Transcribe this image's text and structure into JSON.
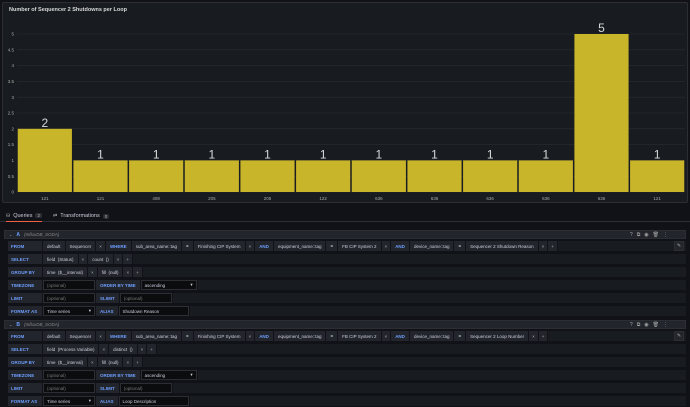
{
  "panel": {
    "title": "Number of Sequencer 2 Shutdowns per Loop"
  },
  "chart_data": {
    "type": "bar",
    "categories": [
      "121",
      "121",
      "408",
      "205",
      "205",
      "122",
      "636",
      "636",
      "636",
      "636",
      "636",
      "121"
    ],
    "values": [
      2,
      1,
      1,
      1,
      1,
      1,
      1,
      1,
      1,
      1,
      5,
      1
    ],
    "ylim": [
      0,
      5
    ],
    "yticks": [
      "0",
      "0.5",
      "1",
      "1.5",
      "2",
      "2.5",
      "3",
      "3.5",
      "4",
      "4.5",
      "5"
    ],
    "bar_color": "#c9b52a",
    "grid": true
  },
  "tabs": [
    {
      "label": "Queries",
      "count": "2",
      "icon": "database-icon"
    },
    {
      "label": "Transformations",
      "count": "0",
      "icon": "transform-icon"
    }
  ],
  "queries": [
    {
      "letter": "A",
      "datasource": "(InfluxDB_SODA)",
      "from": {
        "kw": "FROM",
        "policy": "default",
        "measurement": "Sequencer"
      },
      "where": {
        "kw": "WHERE",
        "conds": [
          {
            "key": "sub_area_name::tag",
            "op": "=",
            "value": "Finishing CIP System",
            "join": "AND"
          },
          {
            "key": "equipment_name::tag",
            "op": "=",
            "value": "FB CIP System 2",
            "join": "AND"
          },
          {
            "key": "device_name::tag",
            "op": "=",
            "value": "Sequencer 2 Shutdown Reason",
            "join": ""
          }
        ]
      },
      "select": {
        "kw": "SELECT",
        "field": "field",
        "field_arg": "(Status)",
        "fn": "count",
        "fn_arg": "()"
      },
      "groupby": {
        "kw": "GROUP BY",
        "time": "time",
        "time_arg": "($__interval)",
        "fill": "fill",
        "fill_arg": "(null)"
      },
      "timezone": {
        "kw": "TIMEZONE",
        "placeholder": "(optional)",
        "order_kw": "ORDER BY TIME",
        "order_value": "ascending"
      },
      "limit": {
        "kw": "LIMIT",
        "placeholder": "(optional)",
        "slimit_kw": "SLIMIT",
        "slimit_placeholder": "(optional)"
      },
      "format": {
        "kw": "FORMAT AS",
        "value": "Time series",
        "alias_kw": "ALIAS",
        "alias_value": "Shutdown Reason"
      }
    },
    {
      "letter": "B",
      "datasource": "(InfluxDB_SODA)",
      "from": {
        "kw": "FROM",
        "policy": "default",
        "measurement": "Sequencer"
      },
      "where": {
        "kw": "WHERE",
        "conds": [
          {
            "key": "sub_area_name::tag",
            "op": "=",
            "value": "Finishing CIP System",
            "join": "AND"
          },
          {
            "key": "equipment_name::tag",
            "op": "=",
            "value": "FB CIP System 2",
            "join": "AND"
          },
          {
            "key": "device_name::tag",
            "op": "=",
            "value": "Sequencer 2 Loop Number",
            "join": ""
          }
        ]
      },
      "select": {
        "kw": "SELECT",
        "field": "field",
        "field_arg": "(Process Variable)",
        "fn": "distinct",
        "fn_arg": "()"
      },
      "groupby": {
        "kw": "GROUP BY",
        "time": "time",
        "time_arg": "($__interval)",
        "fill": "fill",
        "fill_arg": "(null)"
      },
      "timezone": {
        "kw": "TIMEZONE",
        "placeholder": "(optional)",
        "order_kw": "ORDER BY TIME",
        "order_value": "ascending"
      },
      "limit": {
        "kw": "LIMIT",
        "placeholder": "(optional)",
        "slimit_kw": "SLIMIT",
        "slimit_placeholder": "(optional)"
      },
      "format": {
        "kw": "FORMAT AS",
        "value": "Time series",
        "alias_kw": "ALIAS",
        "alias_value": "Loop Description"
      }
    }
  ],
  "symbols": {
    "remove": "×",
    "add": "+",
    "caret": "▾",
    "collapse": "⌄"
  },
  "toolbar_icons": [
    "help-icon",
    "copy-icon",
    "eye-icon",
    "delete-icon",
    "drag-icon"
  ]
}
